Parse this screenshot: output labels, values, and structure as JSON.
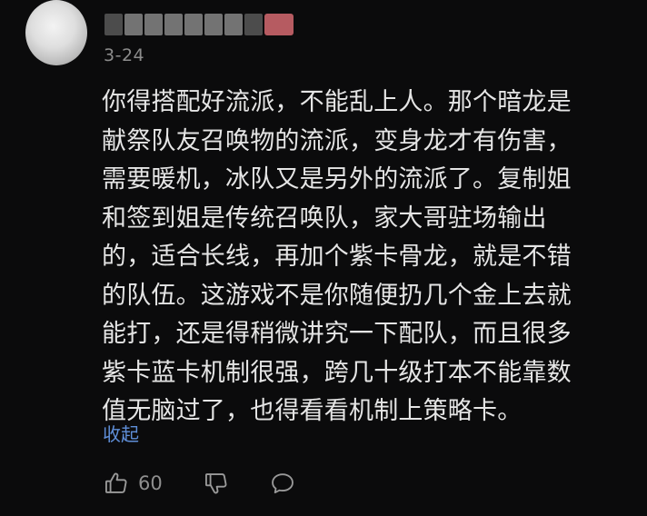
{
  "comment": {
    "username": "",
    "date": "3-24",
    "lines": [
      "你得搭配好流派，不能乱上人。那个暗龙是",
      "献祭队友召唤物的流派，变身龙才有伤害，",
      "需要暖机，冰队又是另外的流派了。复制姐",
      "和签到姐是传统召唤队，家大哥驻场输出",
      "的，适合长线，再加个紫卡骨龙，就是不错",
      "的队伍。这游戏不是你随便扔几个金上去就",
      "能打，还是得稍微讲究一下配队，而且很多",
      "紫卡蓝卡机制很强，跨几十级打本不能靠数",
      "值无脑过了，也得看看机制上策略卡。"
    ],
    "collapse_label": "收起"
  },
  "actions": {
    "like_count": "60",
    "like_icon": "thumbs-up-icon",
    "dislike_icon": "thumbs-down-icon",
    "reply_icon": "speech-bubble-icon"
  },
  "colors": {
    "background": "#0b0b0c",
    "text": "#e5e5e5",
    "meta": "#8c8c8c",
    "link": "#5f8fd9"
  }
}
